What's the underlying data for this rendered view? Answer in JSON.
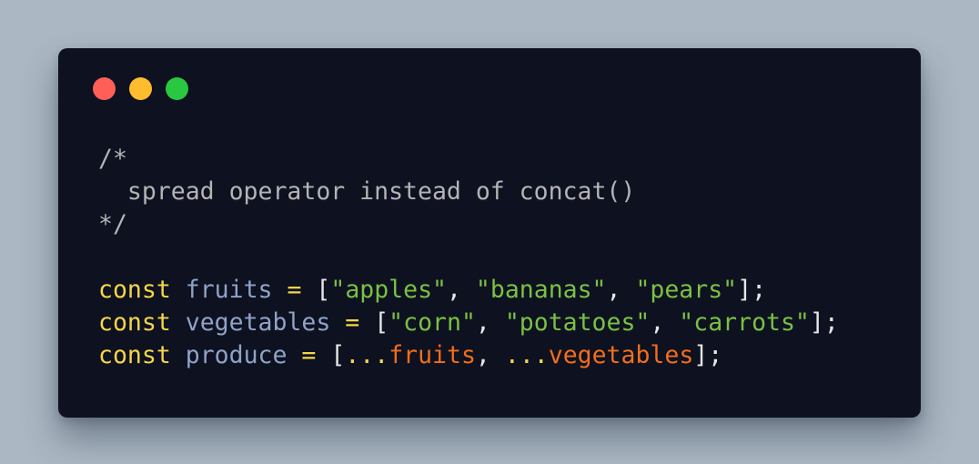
{
  "colors": {
    "background": "#abb8c3",
    "window": "#0d1120",
    "close": "#ff5f57",
    "minimize": "#febc2e",
    "maximize": "#28c840",
    "keyword": "#f5d64a",
    "variable": "#8fa3c7",
    "string": "#7ac143",
    "spread_ref": "#f26d1c",
    "comment": "#b4b4b4"
  },
  "window_controls": {
    "close": "close-button",
    "minimize": "minimize-button",
    "maximize": "maximize-button"
  },
  "code": {
    "comment": {
      "open": "/*",
      "text": "  spread operator instead of concat()",
      "close": "*/"
    },
    "lines": [
      {
        "keyword": "const",
        "name": "fruits",
        "assign": "=",
        "open": "[",
        "items": [
          "\"apples\"",
          "\"bananas\"",
          "\"pears\""
        ],
        "close": "];"
      },
      {
        "keyword": "const",
        "name": "vegetables",
        "assign": "=",
        "open": "[",
        "items": [
          "\"corn\"",
          "\"potatoes\"",
          "\"carrots\""
        ],
        "close": "];"
      }
    ],
    "produce": {
      "keyword": "const",
      "name": "produce",
      "assign": "=",
      "open": "[",
      "spread": "...",
      "refs": [
        "fruits",
        "vegetables"
      ],
      "separator": ",",
      "close": "];"
    }
  }
}
